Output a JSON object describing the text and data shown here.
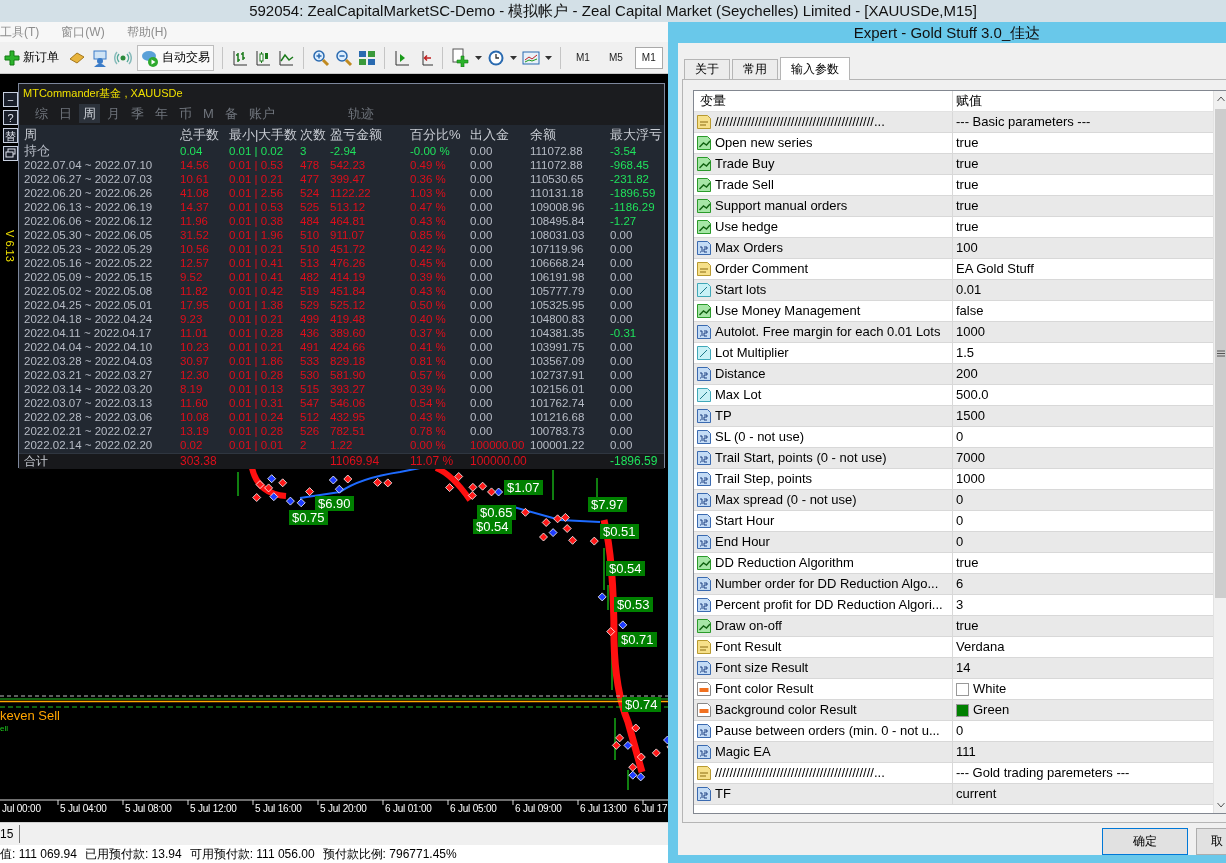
{
  "window": {
    "title": "592054: ZealCapitalMarketSC-Demo - 模拟帐户 - Zeal Capital Market (Seychelles) Limited - [XAUUSDe,M15]"
  },
  "menu": [
    {
      "label": "工具(T)",
      "disabled": true
    },
    {
      "label": "窗口(W)",
      "disabled": true
    },
    {
      "label": "帮助(H)",
      "disabled": true
    }
  ],
  "toolbar": {
    "new_order": "新订单",
    "auto_trading": "自动交易",
    "timeframes": [
      {
        "label": "M1",
        "selected": false
      },
      {
        "label": "M5",
        "selected": false
      },
      {
        "label": "M1",
        "selected": true
      }
    ]
  },
  "side_buttons": [
    "−",
    "?",
    "替"
  ],
  "version": "V 6.13",
  "commander": {
    "title": "MTCommander基金 , XAUUSDe",
    "periods": [
      {
        "label": "综",
        "selected": false
      },
      {
        "label": "日",
        "selected": false
      },
      {
        "label": "周",
        "selected": true
      },
      {
        "label": "月",
        "selected": false
      },
      {
        "label": "季",
        "selected": false
      },
      {
        "label": "年",
        "selected": false
      },
      {
        "label": "币",
        "selected": false
      },
      {
        "label": "M",
        "selected": false
      },
      {
        "label": "备",
        "selected": false
      },
      {
        "label": "账户",
        "selected": false
      },
      {
        "label": "轨迹",
        "selected": false
      }
    ],
    "columns": [
      "周",
      "总手数",
      "最小|大手数",
      "次数",
      "盈亏金额",
      "百分比%",
      "出入金",
      "余额",
      "最大浮亏"
    ],
    "rows": [
      {
        "kind": "holding",
        "cells": [
          "持仓",
          "0.04",
          "0.01 | 0.02",
          "3",
          "-2.94",
          "-0.00 %",
          "0.00",
          "111072.88",
          "-3.54"
        ],
        "deposit_flagged": false,
        "drawdown_flagged": true
      },
      {
        "kind": "week",
        "cells": [
          "2022.07.04 ~ 2022.07.10",
          "14.56",
          "0.01 | 0.53",
          "478",
          "542.23",
          "0.49 %",
          "0.00",
          "111072.88",
          "-968.45"
        ],
        "deposit_flagged": false,
        "drawdown_flagged": true
      },
      {
        "kind": "week",
        "cells": [
          "2022.06.27 ~ 2022.07.03",
          "10.61",
          "0.01 | 0.21",
          "477",
          "399.47",
          "0.36 %",
          "0.00",
          "110530.65",
          "-231.82"
        ],
        "deposit_flagged": false,
        "drawdown_flagged": true
      },
      {
        "kind": "week",
        "cells": [
          "2022.06.20 ~ 2022.06.26",
          "41.08",
          "0.01 | 2.56",
          "524",
          "1122.22",
          "1.03 %",
          "0.00",
          "110131.18",
          "-1896.59"
        ],
        "deposit_flagged": false,
        "drawdown_flagged": true
      },
      {
        "kind": "week",
        "cells": [
          "2022.06.13 ~ 2022.06.19",
          "14.37",
          "0.01 | 0.53",
          "525",
          "513.12",
          "0.47 %",
          "0.00",
          "109008.96",
          "-1186.29"
        ],
        "deposit_flagged": false,
        "drawdown_flagged": true
      },
      {
        "kind": "week",
        "cells": [
          "2022.06.06 ~ 2022.06.12",
          "11.96",
          "0.01 | 0.38",
          "484",
          "464.81",
          "0.43 %",
          "0.00",
          "108495.84",
          "-1.27"
        ],
        "deposit_flagged": false,
        "drawdown_flagged": true
      },
      {
        "kind": "week",
        "cells": [
          "2022.05.30 ~ 2022.06.05",
          "31.52",
          "0.01 | 1.96",
          "510",
          "911.07",
          "0.85 %",
          "0.00",
          "108031.03",
          "0.00"
        ],
        "deposit_flagged": false,
        "drawdown_flagged": false
      },
      {
        "kind": "week",
        "cells": [
          "2022.05.23 ~ 2022.05.29",
          "10.56",
          "0.01 | 0.21",
          "510",
          "451.72",
          "0.42 %",
          "0.00",
          "107119.96",
          "0.00"
        ],
        "deposit_flagged": false,
        "drawdown_flagged": false
      },
      {
        "kind": "week",
        "cells": [
          "2022.05.16 ~ 2022.05.22",
          "12.57",
          "0.01 | 0.41",
          "513",
          "476.26",
          "0.45 %",
          "0.00",
          "106668.24",
          "0.00"
        ],
        "deposit_flagged": false,
        "drawdown_flagged": false
      },
      {
        "kind": "week",
        "cells": [
          "2022.05.09 ~ 2022.05.15",
          "9.52",
          "0.01 | 0.41",
          "482",
          "414.19",
          "0.39 %",
          "0.00",
          "106191.98",
          "0.00"
        ],
        "deposit_flagged": false,
        "drawdown_flagged": false
      },
      {
        "kind": "week",
        "cells": [
          "2022.05.02 ~ 2022.05.08",
          "11.82",
          "0.01 | 0.42",
          "519",
          "451.84",
          "0.43 %",
          "0.00",
          "105777.79",
          "0.00"
        ],
        "deposit_flagged": false,
        "drawdown_flagged": false
      },
      {
        "kind": "week",
        "cells": [
          "2022.04.25 ~ 2022.05.01",
          "17.95",
          "0.01 | 1.38",
          "529",
          "525.12",
          "0.50 %",
          "0.00",
          "105325.95",
          "0.00"
        ],
        "deposit_flagged": false,
        "drawdown_flagged": false
      },
      {
        "kind": "week",
        "cells": [
          "2022.04.18 ~ 2022.04.24",
          "9.23",
          "0.01 | 0.21",
          "499",
          "419.48",
          "0.40 %",
          "0.00",
          "104800.83",
          "0.00"
        ],
        "deposit_flagged": false,
        "drawdown_flagged": false
      },
      {
        "kind": "week",
        "cells": [
          "2022.04.11 ~ 2022.04.17",
          "11.01",
          "0.01 | 0.28",
          "436",
          "389.60",
          "0.37 %",
          "0.00",
          "104381.35",
          "-0.31"
        ],
        "deposit_flagged": false,
        "drawdown_flagged": true
      },
      {
        "kind": "week",
        "cells": [
          "2022.04.04 ~ 2022.04.10",
          "10.23",
          "0.01 | 0.21",
          "491",
          "424.66",
          "0.41 %",
          "0.00",
          "103991.75",
          "0.00"
        ],
        "deposit_flagged": false,
        "drawdown_flagged": false
      },
      {
        "kind": "week",
        "cells": [
          "2022.03.28 ~ 2022.04.03",
          "30.97",
          "0.01 | 1.86",
          "533",
          "829.18",
          "0.81 %",
          "0.00",
          "103567.09",
          "0.00"
        ],
        "deposit_flagged": false,
        "drawdown_flagged": false
      },
      {
        "kind": "week",
        "cells": [
          "2022.03.21 ~ 2022.03.27",
          "12.30",
          "0.01 | 0.28",
          "530",
          "581.90",
          "0.57 %",
          "0.00",
          "102737.91",
          "0.00"
        ],
        "deposit_flagged": false,
        "drawdown_flagged": false
      },
      {
        "kind": "week",
        "cells": [
          "2022.03.14 ~ 2022.03.20",
          "8.19",
          "0.01 | 0.13",
          "515",
          "393.27",
          "0.39 %",
          "0.00",
          "102156.01",
          "0.00"
        ],
        "deposit_flagged": false,
        "drawdown_flagged": false
      },
      {
        "kind": "week",
        "cells": [
          "2022.03.07 ~ 2022.03.13",
          "11.60",
          "0.01 | 0.31",
          "547",
          "546.06",
          "0.54 %",
          "0.00",
          "101762.74",
          "0.00"
        ],
        "deposit_flagged": false,
        "drawdown_flagged": false
      },
      {
        "kind": "week",
        "cells": [
          "2022.02.28 ~ 2022.03.06",
          "10.08",
          "0.01 | 0.24",
          "512",
          "432.95",
          "0.43 %",
          "0.00",
          "101216.68",
          "0.00"
        ],
        "deposit_flagged": false,
        "drawdown_flagged": false
      },
      {
        "kind": "week",
        "cells": [
          "2022.02.21 ~ 2022.02.27",
          "13.19",
          "0.01 | 0.28",
          "526",
          "782.51",
          "0.78 %",
          "0.00",
          "100783.73",
          "0.00"
        ],
        "deposit_flagged": false,
        "drawdown_flagged": false
      },
      {
        "kind": "week",
        "cells": [
          "2022.02.14 ~ 2022.02.20",
          "0.02",
          "0.01 | 0.01",
          "2",
          "1.22",
          "0.00 %",
          "100000.00",
          "100001.22",
          "0.00"
        ],
        "deposit_flagged": true,
        "drawdown_flagged": false
      }
    ],
    "total": {
      "label": "合计",
      "lots": "303.38",
      "profit": "11069.94",
      "percent": "11.07 %",
      "deposit": "100000.00",
      "max_drawdown": "-1896.59"
    }
  },
  "chart": {
    "price_labels": [
      "$6.90",
      "$0.75",
      "$1.07",
      "$0.65",
      "$0.54",
      "$7.97",
      "$0.51",
      "$0.54",
      "$0.53",
      "$0.71",
      "$0.74"
    ],
    "line_label": "keven Sell",
    "line_label_small": "ell",
    "time_axis": [
      "Jul 00:00",
      "5 Jul 04:00",
      "5 Jul 08:00",
      "5 Jul 12:00",
      "5 Jul 16:00",
      "5 Jul 20:00",
      "6 Jul 01:00",
      "6 Jul 05:00",
      "6 Jul 09:00",
      "6 Jul 13:00",
      "6 Jul 17"
    ]
  },
  "terminal_tab": "15",
  "status": [
    "值: 111 069.94",
    "已用预付款: 13.94",
    "可用预付款: 111 056.00",
    "预付款比例: 796771.45%"
  ],
  "dialog": {
    "title": "Expert - Gold Stuff 3.0_佳达",
    "tabs": [
      {
        "label": "关于",
        "selected": false
      },
      {
        "label": "常用",
        "selected": false
      },
      {
        "label": "输入参数",
        "selected": true
      }
    ],
    "columns": [
      "变量",
      "赋值"
    ],
    "params": [
      {
        "kind": "string",
        "name": "////////////////////////////////////////////...",
        "value": "--- Basic parameters ---"
      },
      {
        "kind": "bool",
        "name": "Open new series",
        "value": "true"
      },
      {
        "kind": "bool",
        "name": "Trade Buy",
        "value": "true"
      },
      {
        "kind": "bool",
        "name": "Trade Sell",
        "value": "true"
      },
      {
        "kind": "bool",
        "name": "Support manual orders",
        "value": "true"
      },
      {
        "kind": "bool",
        "name": "Use hedge",
        "value": "true"
      },
      {
        "kind": "int",
        "name": "Max Orders",
        "value": "100"
      },
      {
        "kind": "string",
        "name": "Order Comment",
        "value": "EA Gold Stuff"
      },
      {
        "kind": "double",
        "name": "Start lots",
        "value": "0.01"
      },
      {
        "kind": "bool",
        "name": "Use Money Management",
        "value": "false"
      },
      {
        "kind": "int",
        "name": "Autolot. Free margin for each 0.01 Lots",
        "value": "1000"
      },
      {
        "kind": "double",
        "name": "Lot Multiplier",
        "value": "1.5"
      },
      {
        "kind": "int",
        "name": "Distance",
        "value": "200"
      },
      {
        "kind": "double",
        "name": "Max Lot",
        "value": "500.0"
      },
      {
        "kind": "int",
        "name": "TP",
        "value": "1500"
      },
      {
        "kind": "int",
        "name": "SL (0 - not use)",
        "value": "0"
      },
      {
        "kind": "int",
        "name": "Trail Start, points (0 - not use)",
        "value": "7000"
      },
      {
        "kind": "int",
        "name": "Trail Step, points",
        "value": "1000"
      },
      {
        "kind": "int",
        "name": "Max spread (0 - not use)",
        "value": "0"
      },
      {
        "kind": "int",
        "name": "Start Hour",
        "value": "0"
      },
      {
        "kind": "int",
        "name": "End Hour",
        "value": "0"
      },
      {
        "kind": "bool",
        "name": "DD Reduction Algorithm",
        "value": "true"
      },
      {
        "kind": "int",
        "name": "Number order for DD Reduction Algo...",
        "value": "6"
      },
      {
        "kind": "int",
        "name": "Percent profit for DD Reduction Algori...",
        "value": "3"
      },
      {
        "kind": "bool",
        "name": "Draw on-off",
        "value": "true"
      },
      {
        "kind": "string",
        "name": "Font Result",
        "value": "Verdana"
      },
      {
        "kind": "int",
        "name": "Font size Result",
        "value": "14"
      },
      {
        "kind": "color",
        "name": "Font color Result",
        "value": "White",
        "color": "#ffffff"
      },
      {
        "kind": "color",
        "name": "Background color Result",
        "value": "Green",
        "color": "#008000"
      },
      {
        "kind": "int",
        "name": "Pause between orders (min. 0 - not u...",
        "value": "0"
      },
      {
        "kind": "int",
        "name": "Magic EA",
        "value": "111"
      },
      {
        "kind": "string",
        "name": "////////////////////////////////////////////...",
        "value": "--- Gold trading paremeters ---"
      },
      {
        "kind": "int",
        "name": "TF",
        "value": "current"
      }
    ],
    "buttons": [
      "确定",
      "取"
    ]
  }
}
